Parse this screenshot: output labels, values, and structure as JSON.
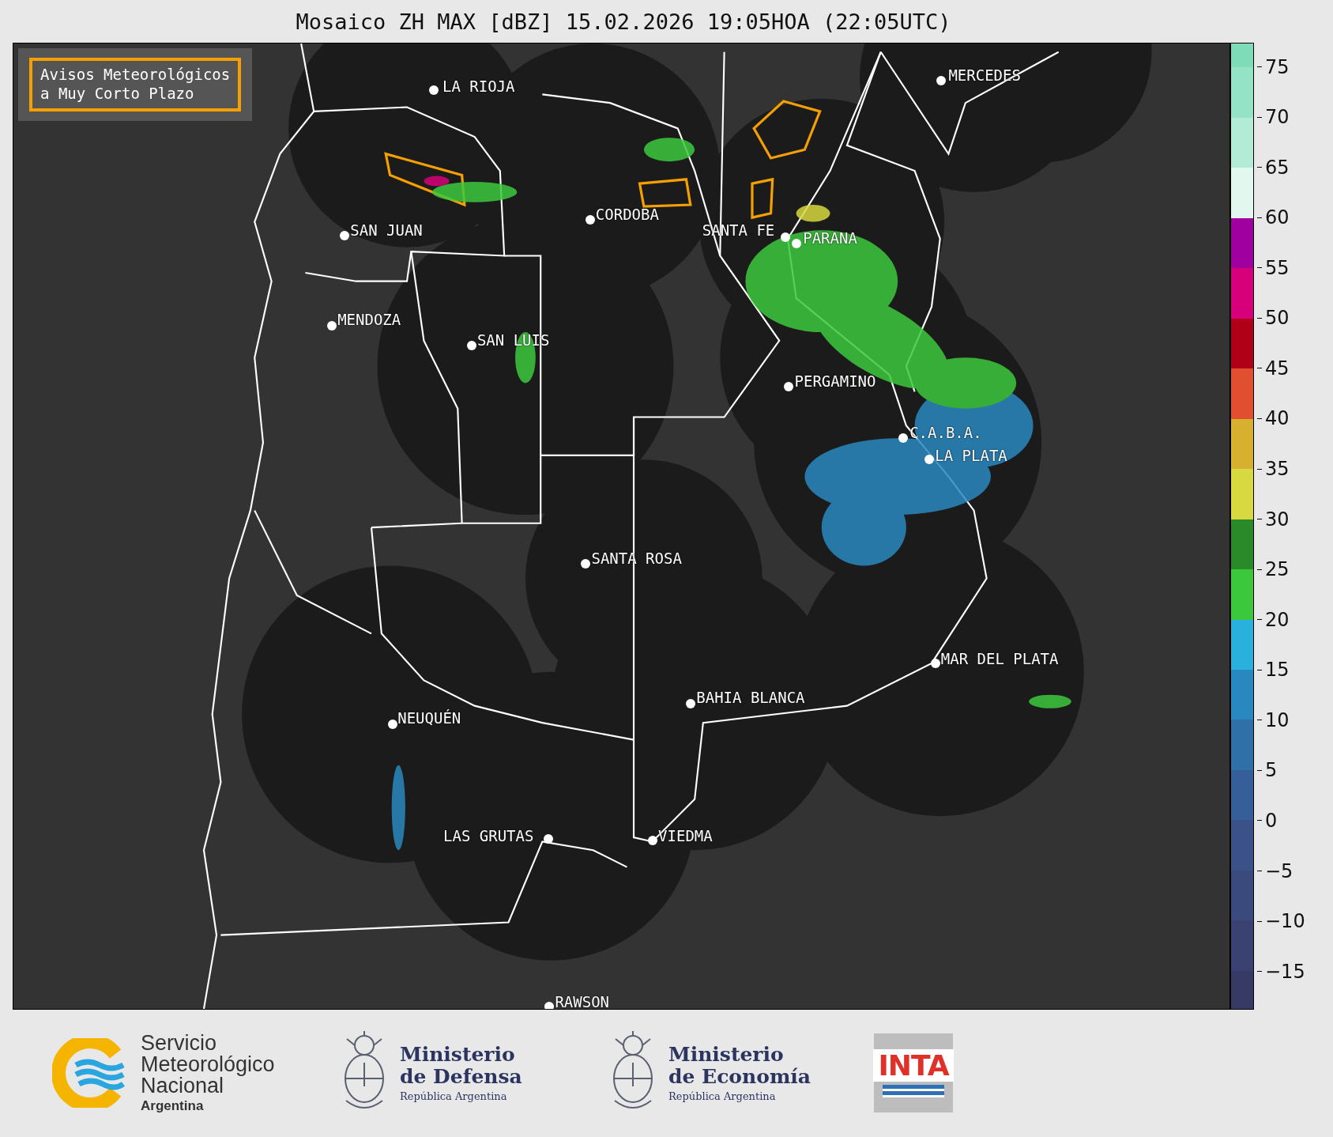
{
  "title": "Mosaico ZH MAX [dBZ] 15.02.2026 19:05HOA (22:05UTC)",
  "warning_legend": {
    "lines": [
      "Avisos Meteorológicos",
      "a Muy Corto Plazo"
    ]
  },
  "cities": [
    {
      "name": "LA RIOJA"
    },
    {
      "name": "MERCEDES"
    },
    {
      "name": "SAN JUAN"
    },
    {
      "name": "CORDOBA"
    },
    {
      "name": "SANTA FE"
    },
    {
      "name": "PARANA"
    },
    {
      "name": "MENDOZA"
    },
    {
      "name": "SAN LUIS"
    },
    {
      "name": "PERGAMINO"
    },
    {
      "name": "C.A.B.A."
    },
    {
      "name": "LA PLATA"
    },
    {
      "name": "SANTA ROSA"
    },
    {
      "name": "MAR DEL PLATA"
    },
    {
      "name": "BAHIA BLANCA"
    },
    {
      "name": "NEUQUÉN"
    },
    {
      "name": "LAS GRUTAS"
    },
    {
      "name": "VIEDMA"
    },
    {
      "name": "RAWSON"
    }
  ],
  "color_scale": {
    "ticks": [
      "75",
      "70",
      "65",
      "60",
      "55",
      "50",
      "45",
      "40",
      "35",
      "30",
      "25",
      "20",
      "15",
      "10",
      "5",
      "0",
      "−5",
      "−10",
      "−15"
    ],
    "segments": [
      {
        "color": "#7fdcb9"
      },
      {
        "color": "#95e3c6"
      },
      {
        "color": "#b3ecd6"
      },
      {
        "color": "#e2f7ee"
      },
      {
        "color": "#a000a0"
      },
      {
        "color": "#d8007a"
      },
      {
        "color": "#b00018"
      },
      {
        "color": "#e05030"
      },
      {
        "color": "#d8b030"
      },
      {
        "color": "#d8d840"
      },
      {
        "color": "#2a8a2a"
      },
      {
        "color": "#3cc83c"
      },
      {
        "color": "#2ab0dc"
      },
      {
        "color": "#2a88c0"
      },
      {
        "color": "#3070a8"
      },
      {
        "color": "#365e98"
      },
      {
        "color": "#3a5288"
      },
      {
        "color": "#3a4a7c"
      },
      {
        "color": "#3a4272"
      },
      {
        "color": "#383a66"
      }
    ]
  },
  "logos": [
    {
      "kind": "smn",
      "lines": [
        "Servicio",
        "Meteorológico",
        "Nacional"
      ],
      "subtitle": "Argentina"
    },
    {
      "kind": "ministry",
      "lines": [
        "Ministerio",
        "de Defensa"
      ],
      "subtitle": "República Argentina"
    },
    {
      "kind": "ministry",
      "lines": [
        "Ministerio",
        "de Economía"
      ],
      "subtitle": "República Argentina"
    },
    {
      "kind": "inta",
      "text": "INTA"
    }
  ]
}
